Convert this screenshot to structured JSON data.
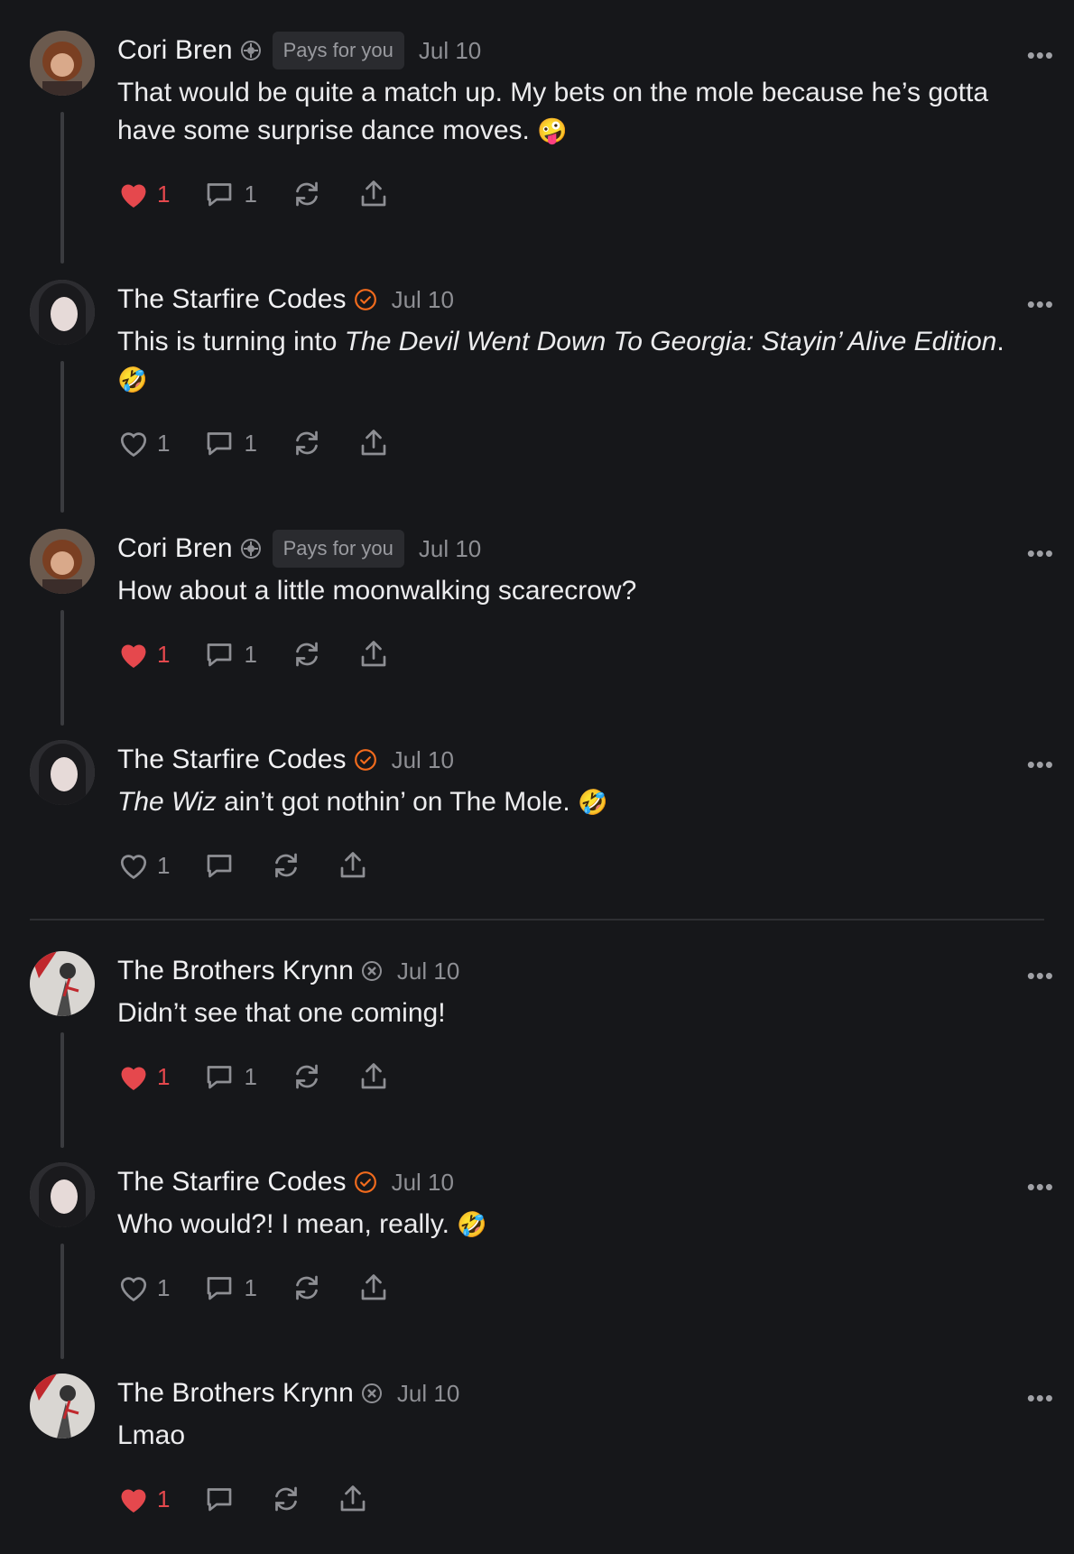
{
  "comments": [
    {
      "author": "Cori Bren",
      "badge": "Pays for you",
      "date": "Jul 10",
      "text": "That would be quite a match up. My bets on the mole because he’s gotta have some surprise dance moves.",
      "emoji": "🤪",
      "likes": "1",
      "liked": true,
      "replies": "1"
    },
    {
      "author": "The Starfire Codes",
      "date": "Jul 10",
      "text_prefix": "This is turning into ",
      "text_italic": "The Devil Went Down To Georgia: Stayin’ Alive Edition",
      "text_suffix": ".",
      "emoji": "🤣",
      "likes": "1",
      "liked": false,
      "replies": "1"
    },
    {
      "author": "Cori Bren",
      "badge": "Pays for you",
      "date": "Jul 10",
      "text": "How about a little moonwalking scarecrow?",
      "likes": "1",
      "liked": true,
      "replies": "1"
    },
    {
      "author": "The Starfire Codes",
      "date": "Jul 10",
      "text_italic": "The Wiz",
      "text_suffix": " ain’t got nothin’ on The Mole.",
      "emoji": "🤣",
      "likes": "1",
      "liked": false,
      "replies": ""
    },
    {
      "author": "The Brothers Krynn",
      "date": "Jul 10",
      "text": "Didn’t see that one coming!",
      "likes": "1",
      "liked": true,
      "replies": "1"
    },
    {
      "author": "The Starfire Codes",
      "date": "Jul 10",
      "text": "Who would?! I mean, really.",
      "emoji": "🤣",
      "likes": "1",
      "liked": false,
      "replies": "1"
    },
    {
      "author": "The Brothers Krynn",
      "date": "Jul 10",
      "text": "Lmao",
      "likes": "1",
      "liked": true,
      "replies": ""
    }
  ],
  "more_label": "•••",
  "colors": {
    "accent_like": "#e5484d",
    "verified_orange": "#f26b1d",
    "background": "#16171a"
  },
  "icons": [
    "heart-icon",
    "comment-icon",
    "restack-icon",
    "share-icon",
    "more-icon",
    "verified-icon",
    "subscriber-icon"
  ]
}
